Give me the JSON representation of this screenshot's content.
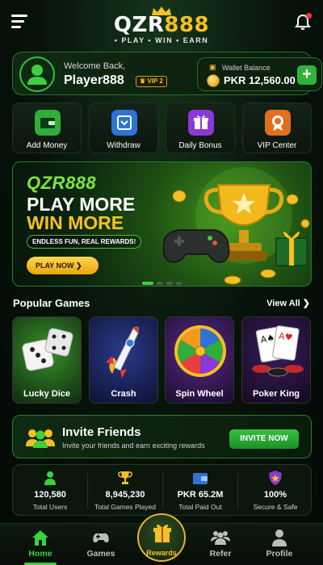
{
  "header": {
    "logo_main": "QZR",
    "logo_num": "888",
    "tagline": "• PLAY • WIN • EARN",
    "menu_icon": "hamburger-menu-icon",
    "bell_icon": "bell-icon"
  },
  "welcome": {
    "greeting": "Welcome Back,",
    "username": "Player888",
    "vip": "♛ VIP 2",
    "wallet_label": "Wallet Balance",
    "balance": "PKR 12,560.00",
    "add_label": "+"
  },
  "actions": [
    {
      "label": "Add Money",
      "icon": "wallet-icon",
      "color": "#2fae3b"
    },
    {
      "label": "Withdraw",
      "icon": "withdraw-icon",
      "color": "#2f73d9"
    },
    {
      "label": "Daily Bonus",
      "icon": "gift-icon",
      "color": "#8a38d6"
    },
    {
      "label": "VIP Center",
      "icon": "vip-medal-icon",
      "color": "#e0701e"
    }
  ],
  "banner": {
    "brand": "QZR888",
    "line1": "PLAY MORE",
    "line2": "WIN MORE",
    "subtitle": "ENDLESS FUN, REAL REWARDS!",
    "button": "PLAY NOW ❯",
    "slides": 4,
    "active_slide": 1
  },
  "popular": {
    "title": "Popular Games",
    "view_all": "View All ❯",
    "games": [
      {
        "name": "Lucky Dice",
        "icon": "dice-icon"
      },
      {
        "name": "Crash",
        "icon": "rocket-icon"
      },
      {
        "name": "Spin Wheel",
        "icon": "wheel-icon"
      },
      {
        "name": "Poker King",
        "icon": "cards-icon"
      }
    ]
  },
  "invite": {
    "title": "Invite Friends",
    "subtitle": "Invite your friends and earn exciting rewards",
    "button": "INVITE NOW"
  },
  "stats": [
    {
      "value": "120,580",
      "label": "Total Users"
    },
    {
      "value": "8,945,230",
      "label": "Total Games Played"
    },
    {
      "value": "PKR 65.2M",
      "label": "Total Paid Out"
    },
    {
      "value": "100%",
      "label": "Secure & Safe"
    }
  ],
  "nav": {
    "home": "Home",
    "games": "Games",
    "rewards": "Rewards",
    "refer": "Refer",
    "profile": "Profile"
  },
  "colors": {
    "accent": "#3ed03e",
    "gold": "#f5c022",
    "background": "#07120a"
  }
}
